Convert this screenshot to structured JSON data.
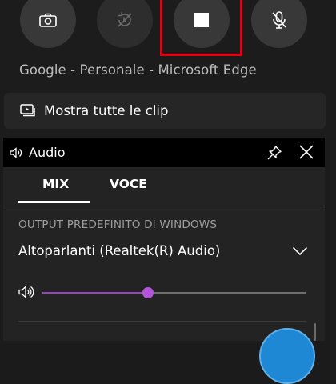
{
  "capture": {
    "window_title": "Google - Personale - Microsoft Edge",
    "show_clips_label": "Mostra tutte le clip",
    "buttons": [
      {
        "name": "screenshot",
        "icon": "camera-icon"
      },
      {
        "name": "record-last-30s",
        "icon": "replay-disabled-icon"
      },
      {
        "name": "stop-recording",
        "icon": "stop-icon"
      },
      {
        "name": "mic-toggle",
        "icon": "mic-muted-icon"
      }
    ],
    "highlight_color": "#e60012"
  },
  "audio": {
    "title": "Audio",
    "tabs": [
      {
        "label": "MIX",
        "selected": true
      },
      {
        "label": "VOCE",
        "selected": false
      }
    ],
    "section_label": "OUTPUT PREDEFINITO DI WINDOWS",
    "device": "Altoparlanti (Realtek(R) Audio)",
    "volume": 0.4,
    "accent_color": "#a33ec7"
  }
}
